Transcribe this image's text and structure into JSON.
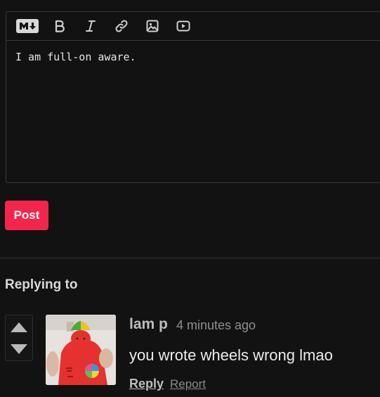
{
  "editor": {
    "text": "I am full-on aware.",
    "toolbar": [
      {
        "icon": "markdown-icon"
      },
      {
        "icon": "bold-icon"
      },
      {
        "icon": "italic-icon"
      },
      {
        "icon": "link-icon"
      },
      {
        "icon": "image-icon"
      },
      {
        "icon": "video-icon"
      }
    ]
  },
  "post_button": {
    "label": "Post",
    "color": "#f4254a"
  },
  "reply_section": {
    "heading": "Replying to",
    "comment": {
      "author": "lam p",
      "timestamp": "4 minutes ago",
      "body": "you wrote wheels wrong lmao",
      "reply_label": "Reply",
      "report_label": "Report"
    }
  }
}
